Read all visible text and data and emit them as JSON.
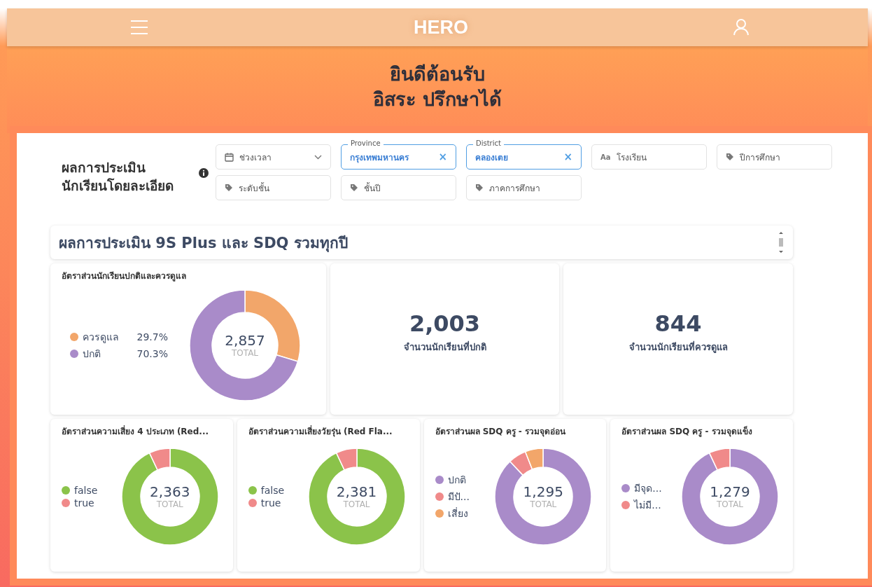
{
  "header": {
    "logo": "HERO"
  },
  "welcome": [
    "ยินดีต้อนรับ",
    "อิสระ ปรึกษาได้"
  ],
  "filters_panel": {
    "title": "ผลการประเมิน\nนักเรียนโดยละเอียด",
    "filters": [
      {
        "kind": "date",
        "placeholder": "ช่วงเวลา"
      },
      {
        "kind": "active",
        "label": "Province",
        "value": "กรุงเทพมหานคร",
        "clear": "×"
      },
      {
        "kind": "active",
        "label": "District",
        "value": "คลองเตย",
        "clear": "×"
      },
      {
        "kind": "text",
        "icon_text": "Aa",
        "placeholder": "โรงเรียน"
      },
      {
        "kind": "tag",
        "placeholder": "ปีการศึกษา"
      },
      {
        "kind": "tag",
        "placeholder": "ระดับชั้น"
      },
      {
        "kind": "tag",
        "placeholder": "ชั้นปี"
      },
      {
        "kind": "tag",
        "placeholder": "ภาคการศึกษา"
      }
    ]
  },
  "dashboard_title": "ผลการประเมิน 9S Plus และ SDQ รวมทุกปี",
  "top_cards": [
    {
      "kind": "donut",
      "title": "อัตราส่วนนักเรียนปกติและควรดูแล",
      "total": "2,857",
      "total_label": "TOTAL",
      "legend": [
        {
          "color": "#f2a66a",
          "percent": "29.7%"
        },
        {
          "color": "#a98bc9",
          "percent": "70.3%"
        }
      ],
      "chart_data": {
        "type": "donut",
        "categories": [
          "ควรดูแล",
          "ปกติ"
        ],
        "values": [
          29.7,
          70.3
        ]
      }
    },
    {
      "kind": "number",
      "value": "2,003",
      "caption": "จำนวนนักเรียนที่ปกติ"
    },
    {
      "kind": "number",
      "value": "844",
      "caption": "จำนวนนักเรียนที่ควรดูแล"
    }
  ],
  "bottom_cards": [
    {
      "kind": "donut",
      "title": "อัตราส่วนความเสี่ยง 4 ประเภท (Red...",
      "total": "2,363",
      "total_label": "TOTAL",
      "legend": [
        {
          "color": "#8bc34a"
        },
        {
          "color": "#f08a8a"
        }
      ],
      "chart_data": {
        "type": "donut",
        "categories": [
          "false",
          "true"
        ],
        "values": [
          93,
          7
        ]
      }
    },
    {
      "kind": "donut",
      "title": "อัตราส่วนความเสี่ยงวัยรุ่น (Red Fla...",
      "total": "2,381",
      "total_label": "TOTAL",
      "legend": [
        {
          "color": "#8bc34a"
        },
        {
          "color": "#f08a8a"
        }
      ],
      "chart_data": {
        "type": "donut",
        "categories": [
          "false",
          "true"
        ],
        "values": [
          93,
          7
        ]
      }
    },
    {
      "kind": "donut",
      "title": "อัตราส่วนผล SDQ ครู - รวมจุดอ่อน",
      "total": "1,295",
      "total_label": "TOTAL",
      "legend": [
        {
          "color": "#a98bc9"
        },
        {
          "color": "#f08a8a"
        },
        {
          "color": "#f2a66a"
        }
      ],
      "chart_data": {
        "type": "donut",
        "categories": [
          "ปกติ",
          "มีปั...",
          "เสี่ยง"
        ],
        "values": [
          88,
          6,
          6
        ]
      }
    },
    {
      "kind": "donut",
      "title": "อัตราส่วนผล SDQ ครู - รวมจุดแข็ง",
      "total": "1,279",
      "total_label": "TOTAL",
      "legend": [
        {
          "color": "#a98bc9"
        },
        {
          "color": "#f08a8a"
        }
      ],
      "chart_data": {
        "type": "donut",
        "categories": [
          "มีจุด...",
          "ไม่มี..."
        ],
        "values": [
          93,
          7
        ]
      }
    }
  ]
}
